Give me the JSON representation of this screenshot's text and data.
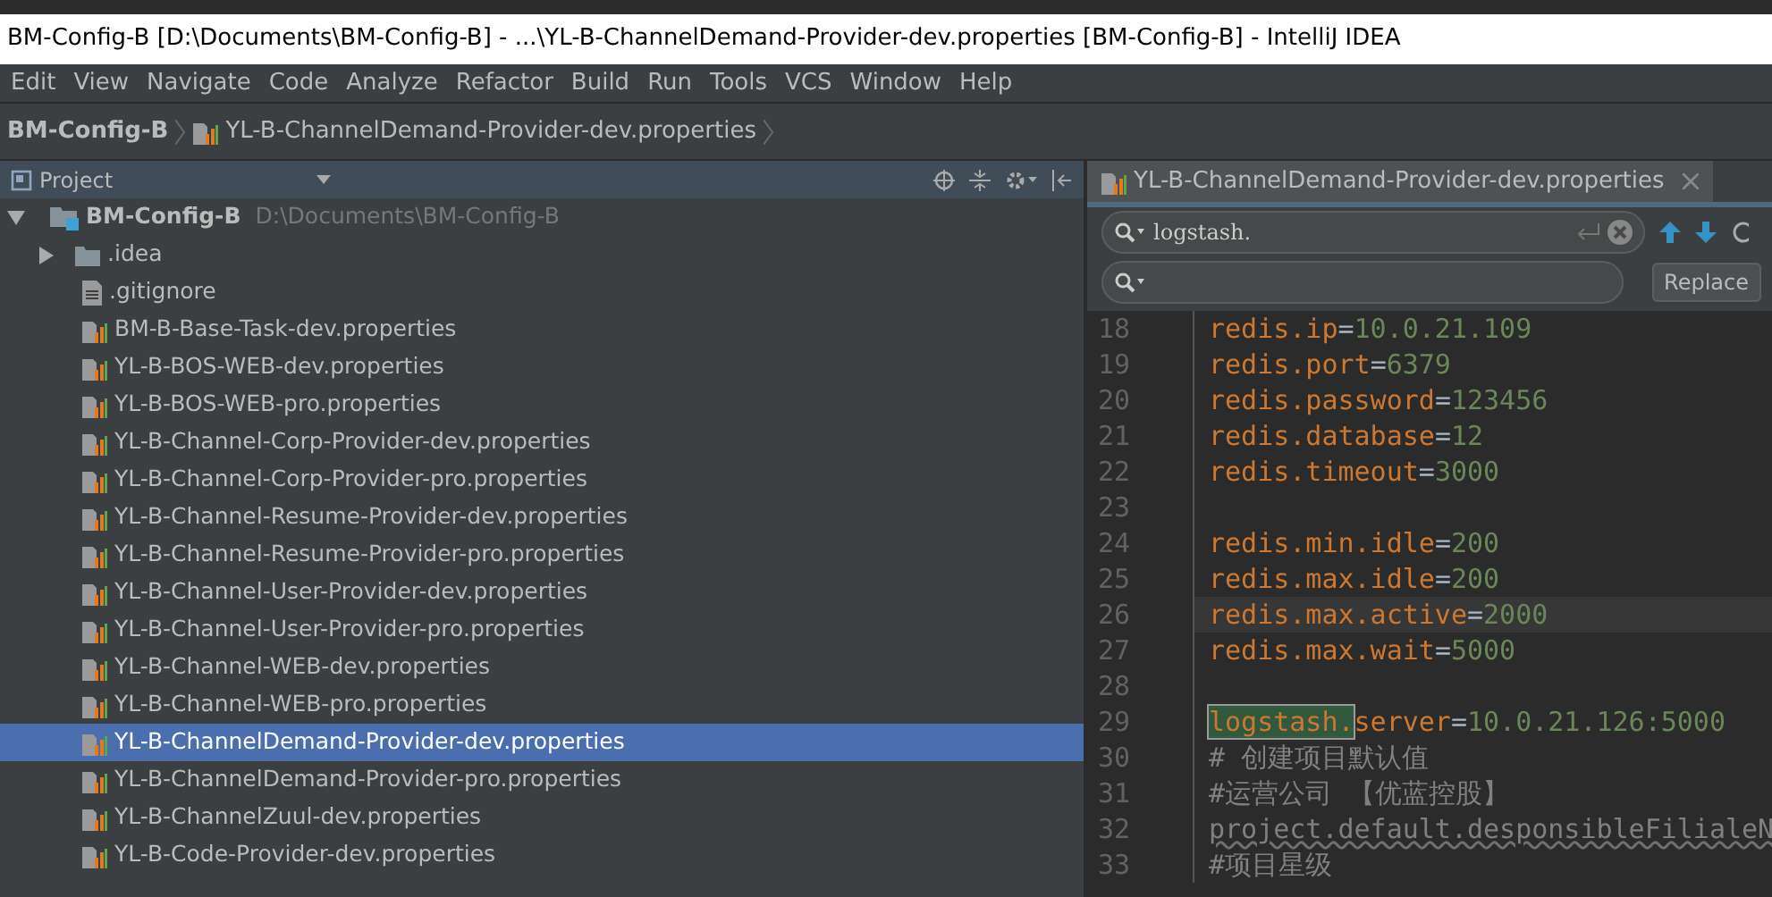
{
  "window": {
    "title": "BM-Config-B [D:\\Documents\\BM-Config-B] - ...\\YL-B-ChannelDemand-Provider-dev.properties [BM-Config-B] - IntelliJ IDEA"
  },
  "menu": [
    "Edit",
    "View",
    "Navigate",
    "Code",
    "Analyze",
    "Refactor",
    "Build",
    "Run",
    "Tools",
    "VCS",
    "Window",
    "Help"
  ],
  "breadcrumb": [
    {
      "label": "BM-Config-B",
      "kind": "project"
    },
    {
      "label": "YL-B-ChannelDemand-Provider-dev.properties",
      "kind": "file"
    }
  ],
  "project_panel": {
    "title": "Project",
    "tree": {
      "label": "BM-Config-B",
      "path": "D:\\Documents\\BM-Config-B",
      "expanded": true,
      "children": [
        {
          "label": ".idea",
          "kind": "folder",
          "expanded": false,
          "selected": false
        },
        {
          "label": ".gitignore",
          "kind": "text",
          "selected": false
        },
        {
          "label": "BM-B-Base-Task-dev.properties",
          "kind": "properties",
          "selected": false
        },
        {
          "label": "YL-B-BOS-WEB-dev.properties",
          "kind": "properties",
          "selected": false
        },
        {
          "label": "YL-B-BOS-WEB-pro.properties",
          "kind": "properties",
          "selected": false
        },
        {
          "label": "YL-B-Channel-Corp-Provider-dev.properties",
          "kind": "properties",
          "selected": false
        },
        {
          "label": "YL-B-Channel-Corp-Provider-pro.properties",
          "kind": "properties",
          "selected": false
        },
        {
          "label": "YL-B-Channel-Resume-Provider-dev.properties",
          "kind": "properties",
          "selected": false
        },
        {
          "label": "YL-B-Channel-Resume-Provider-pro.properties",
          "kind": "properties",
          "selected": false
        },
        {
          "label": "YL-B-Channel-User-Provider-dev.properties",
          "kind": "properties",
          "selected": false
        },
        {
          "label": "YL-B-Channel-User-Provider-pro.properties",
          "kind": "properties",
          "selected": false
        },
        {
          "label": "YL-B-Channel-WEB-dev.properties",
          "kind": "properties",
          "selected": false
        },
        {
          "label": "YL-B-Channel-WEB-pro.properties",
          "kind": "properties",
          "selected": false
        },
        {
          "label": "YL-B-ChannelDemand-Provider-dev.properties",
          "kind": "properties",
          "selected": true
        },
        {
          "label": "YL-B-ChannelDemand-Provider-pro.properties",
          "kind": "properties",
          "selected": false
        },
        {
          "label": "YL-B-ChannelZuul-dev.properties",
          "kind": "properties",
          "selected": false
        },
        {
          "label": "YL-B-Code-Provider-dev.properties",
          "kind": "properties",
          "selected": false
        }
      ]
    }
  },
  "editor": {
    "tab": {
      "label": "YL-B-ChannelDemand-Provider-dev.properties"
    },
    "search": {
      "query": "logstash."
    },
    "replace": {
      "button": "Replace"
    },
    "lines": [
      {
        "number": "18",
        "kind": "property",
        "key": "redis.ip",
        "separator": "=",
        "value": "10.0.21.109",
        "current": false
      },
      {
        "number": "19",
        "kind": "property",
        "key": "redis.port",
        "separator": "=",
        "value": "6379",
        "current": false
      },
      {
        "number": "20",
        "kind": "property",
        "key": "redis.password",
        "separator": "=",
        "value": "123456",
        "current": false
      },
      {
        "number": "21",
        "kind": "property",
        "key": "redis.database",
        "separator": "=",
        "value": "12",
        "current": false
      },
      {
        "number": "22",
        "kind": "property",
        "key": "redis.timeout",
        "separator": "=",
        "value": "3000",
        "current": false
      },
      {
        "number": "23",
        "kind": "blank",
        "current": false
      },
      {
        "number": "24",
        "kind": "property",
        "key": "redis.min.idle",
        "separator": "=",
        "value": "200",
        "current": false
      },
      {
        "number": "25",
        "kind": "property",
        "key": "redis.max.idle",
        "separator": "=",
        "value": "200",
        "current": false
      },
      {
        "number": "26",
        "kind": "property",
        "key": "redis.max.active",
        "separator": "=",
        "value": "2000",
        "current": true
      },
      {
        "number": "27",
        "kind": "property",
        "key": "redis.max.wait",
        "separator": "=",
        "value": "5000",
        "current": false
      },
      {
        "number": "28",
        "kind": "blank",
        "current": false
      },
      {
        "number": "29",
        "kind": "property",
        "match": "logstash.",
        "key": "server",
        "separator": "=",
        "value": "10.0.21.126:5000",
        "current": false
      },
      {
        "number": "30",
        "kind": "comment",
        "text": "# 创建项目默认值",
        "current": false
      },
      {
        "number": "31",
        "kind": "comment",
        "text": "#运营公司  【优蓝控股】",
        "current": false
      },
      {
        "number": "32",
        "kind": "unknown-key",
        "text": "project.default.desponsibleFilialeN",
        "current": false
      },
      {
        "number": "33",
        "kind": "comment",
        "text": "#项目星级",
        "current": false
      }
    ]
  }
}
